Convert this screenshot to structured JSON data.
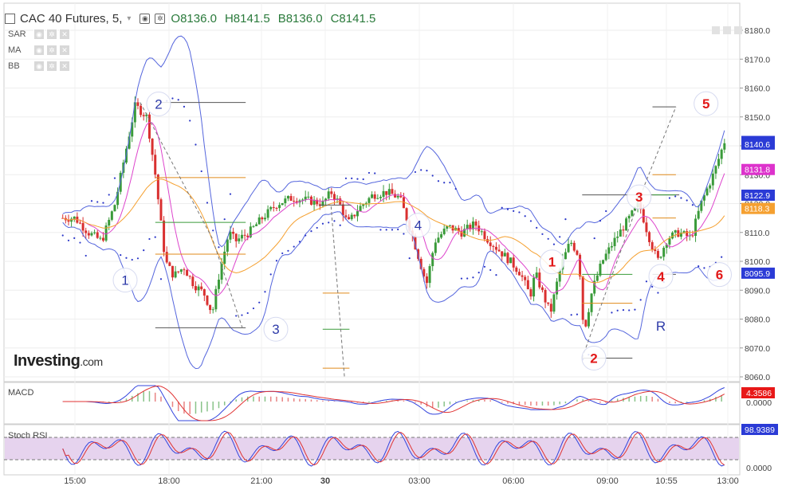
{
  "header": {
    "symbol": "CAC 40 Futures, 5,",
    "open": "O8136.0",
    "high": "H8141.5",
    "low": "B8136.0",
    "close": "C8141.5"
  },
  "indicators": [
    "SAR",
    "MA",
    "BB"
  ],
  "logo": {
    "brand": "Investing",
    "suffix": ".com"
  },
  "macd_label": "MACD",
  "stoch_label": "Stoch RSI",
  "colors": {
    "up": "#3a9b3a",
    "down": "#d93030",
    "bollinger": "#5566dd",
    "ma_fast": "#dd44cc",
    "ma_slow": "#f5a030",
    "sar": "#2a36c8",
    "wave_red": "#e21818",
    "wave_blue": "#2d3aa8",
    "price_tag": "#2b3bd6"
  },
  "chart_data": {
    "type": "candlestick",
    "y_axis": {
      "ylim": [
        8057,
        8187
      ],
      "ticks": [
        "8180.0",
        "8170.0",
        "8160.0",
        "8150.0",
        "8140.0",
        "8130.0",
        "8120.0",
        "8110.0",
        "8100.0",
        "8090.0",
        "8080.0",
        "8070.0",
        "8060.0"
      ]
    },
    "x_axis": {
      "ticks": [
        "15:00",
        "18:00",
        "21:00",
        "30",
        "03:00",
        "06:00",
        "09:00",
        "10:55",
        "13:00"
      ]
    },
    "price_tags": [
      {
        "label": "8141.5",
        "value": 8141.5,
        "color": "#2b3bd6"
      },
      {
        "label": "8140.6",
        "value": 8140.6,
        "color": "#2b3bd6"
      },
      {
        "label": "8131.8",
        "value": 8131.8,
        "color": "#dd33cc"
      },
      {
        "label": "8122.9",
        "value": 8122.9,
        "color": "#2b3bd6"
      },
      {
        "label": "8118.3",
        "value": 8118.3,
        "color": "#f5a030"
      },
      {
        "label": "8095.9",
        "value": 8095.9,
        "color": "#2b3bd6"
      }
    ],
    "macd": {
      "value_label": "4.3586",
      "zero_label": "0.0000"
    },
    "stoch_rsi": {
      "value_label": "98.9389",
      "zero_label": "0.0000"
    },
    "wave_labels": [
      {
        "text": "1",
        "tick": 3,
        "value": 8093.5,
        "color": "blue"
      },
      {
        "text": "2",
        "tick": 5,
        "value": 8154.5,
        "color": "blue"
      },
      {
        "text": "3",
        "tick": 12,
        "value": 8076.5,
        "color": "blue"
      },
      {
        "text": "4",
        "tick": 20.5,
        "value": 8112.5,
        "color": "blue"
      },
      {
        "text": "1",
        "tick": 28.5,
        "value": 8099.8,
        "color": "red"
      },
      {
        "text": "2",
        "tick": 31,
        "value": 8066.5,
        "color": "red"
      },
      {
        "text": "3",
        "tick": 33.7,
        "value": 8122.3,
        "color": "red"
      },
      {
        "text": "4",
        "tick": 35,
        "value": 8094.8,
        "color": "red"
      },
      {
        "text": "5",
        "tick": 37.7,
        "value": 8154.6,
        "color": "red"
      },
      {
        "text": "6",
        "tick": 38.5,
        "value": 8095.4,
        "color": "red"
      },
      {
        "text": "R",
        "tick": 35,
        "value": 8077.6,
        "color": "blue"
      }
    ],
    "levels": [
      {
        "value": 8155.0,
        "t0": 4.8,
        "t1": 10.2,
        "color": "#555555"
      },
      {
        "value": 8129.0,
        "t0": 4.8,
        "t1": 10.2,
        "color": "#e08a1a"
      },
      {
        "value": 8113.5,
        "t0": 4.8,
        "t1": 10.2,
        "color": "#3a9b3a"
      },
      {
        "value": 8102.5,
        "t0": 4.8,
        "t1": 10.2,
        "color": "#e08a1a"
      },
      {
        "value": 8077.0,
        "t0": 4.8,
        "t1": 10.2,
        "color": "#555555"
      },
      {
        "value": 8119.5,
        "t0": 14.6,
        "t1": 16.5,
        "color": "#555555"
      },
      {
        "value": 8089.0,
        "t0": 14.8,
        "t1": 16.4,
        "color": "#e08a1a"
      },
      {
        "value": 8076.5,
        "t0": 14.8,
        "t1": 16.4,
        "color": "#3a9b3a"
      },
      {
        "value": 8063.0,
        "t0": 14.8,
        "t1": 16.4,
        "color": "#e08a1a"
      },
      {
        "value": 8123.0,
        "t0": 30.3,
        "t1": 36.1,
        "color": "#555555"
      },
      {
        "value": 8095.5,
        "t0": 30.3,
        "t1": 33.3,
        "color": "#3a9b3a"
      },
      {
        "value": 8085.5,
        "t0": 30.3,
        "t1": 33.3,
        "color": "#e08a1a"
      },
      {
        "value": 8066.5,
        "t0": 30.3,
        "t1": 33.3,
        "color": "#555555"
      },
      {
        "value": 8153.5,
        "t0": 34.5,
        "t1": 35.9,
        "color": "#555555"
      },
      {
        "value": 8130.0,
        "t0": 34.5,
        "t1": 35.9,
        "color": "#e08a1a"
      },
      {
        "value": 8123.0,
        "t0": 34.5,
        "t1": 35.9,
        "color": "#3a9b3a"
      },
      {
        "value": 8115.0,
        "t0": 34.5,
        "t1": 35.9,
        "color": "#e08a1a"
      },
      {
        "value": 8095.5,
        "t0": 34.5,
        "t1": 35.9,
        "color": "#555555"
      }
    ],
    "wave_path_blue": [
      {
        "t": 3.9,
        "v": 8155.0
      },
      {
        "t": 8.2,
        "v": 8108.0
      },
      {
        "t": 10.0,
        "v": 8077.0
      }
    ],
    "wave_path_rise": [
      {
        "t": 30.3,
        "v": 8066.5
      },
      {
        "t": 34.0,
        "v": 8126.0
      },
      {
        "t": 35.9,
        "v": 8153.5
      }
    ],
    "wave_path_drop": [
      {
        "t": 15.3,
        "v": 8119.0
      },
      {
        "t": 16.1,
        "v": 8060.0
      }
    ],
    "price_path": [
      {
        "t": 0.0,
        "v": 8115
      },
      {
        "t": 0.8,
        "v": 8110
      },
      {
        "t": 1.6,
        "v": 8107
      },
      {
        "t": 2.4,
        "v": 8120
      },
      {
        "t": 3.1,
        "v": 8140
      },
      {
        "t": 3.6,
        "v": 8154
      },
      {
        "t": 4.3,
        "v": 8150
      },
      {
        "t": 4.8,
        "v": 8130
      },
      {
        "t": 5.4,
        "v": 8100
      },
      {
        "t": 5.9,
        "v": 8095
      },
      {
        "t": 6.5,
        "v": 8098
      },
      {
        "t": 7.1,
        "v": 8092
      },
      {
        "t": 7.7,
        "v": 8089
      },
      {
        "t": 8.2,
        "v": 8082
      },
      {
        "t": 8.6,
        "v": 8095
      },
      {
        "t": 9.2,
        "v": 8110
      },
      {
        "t": 9.6,
        "v": 8107
      },
      {
        "t": 10.4,
        "v": 8110
      },
      {
        "t": 11.2,
        "v": 8115
      },
      {
        "t": 12.1,
        "v": 8120
      },
      {
        "t": 13.0,
        "v": 8122
      },
      {
        "t": 14.0,
        "v": 8121
      },
      {
        "t": 14.8,
        "v": 8120
      },
      {
        "t": 15.3,
        "v": 8124
      },
      {
        "t": 15.8,
        "v": 8120
      },
      {
        "t": 16.3,
        "v": 8113
      },
      {
        "t": 16.9,
        "v": 8118
      },
      {
        "t": 17.8,
        "v": 8123
      },
      {
        "t": 18.6,
        "v": 8124
      },
      {
        "t": 19.4,
        "v": 8122
      },
      {
        "t": 20.1,
        "v": 8110
      },
      {
        "t": 20.6,
        "v": 8100
      },
      {
        "t": 21.0,
        "v": 8092
      },
      {
        "t": 21.5,
        "v": 8107
      },
      {
        "t": 22.3,
        "v": 8112
      },
      {
        "t": 23.1,
        "v": 8110
      },
      {
        "t": 23.9,
        "v": 8113
      },
      {
        "t": 24.6,
        "v": 8108
      },
      {
        "t": 25.3,
        "v": 8104
      },
      {
        "t": 26.0,
        "v": 8100
      },
      {
        "t": 26.6,
        "v": 8096
      },
      {
        "t": 27.2,
        "v": 8088
      },
      {
        "t": 27.5,
        "v": 8096
      },
      {
        "t": 28.0,
        "v": 8088
      },
      {
        "t": 28.4,
        "v": 8082
      },
      {
        "t": 29.0,
        "v": 8098
      },
      {
        "t": 29.6,
        "v": 8107
      },
      {
        "t": 30.1,
        "v": 8102
      },
      {
        "t": 30.4,
        "v": 8075
      },
      {
        "t": 30.9,
        "v": 8090
      },
      {
        "t": 31.5,
        "v": 8100
      },
      {
        "t": 32.2,
        "v": 8107
      },
      {
        "t": 33.0,
        "v": 8114
      },
      {
        "t": 33.7,
        "v": 8120
      },
      {
        "t": 34.2,
        "v": 8110
      },
      {
        "t": 34.8,
        "v": 8100
      },
      {
        "t": 35.4,
        "v": 8108
      },
      {
        "t": 36.1,
        "v": 8110
      },
      {
        "t": 36.8,
        "v": 8108
      },
      {
        "t": 37.4,
        "v": 8120
      },
      {
        "t": 38.2,
        "v": 8131
      },
      {
        "t": 38.8,
        "v": 8141.5
      }
    ]
  }
}
